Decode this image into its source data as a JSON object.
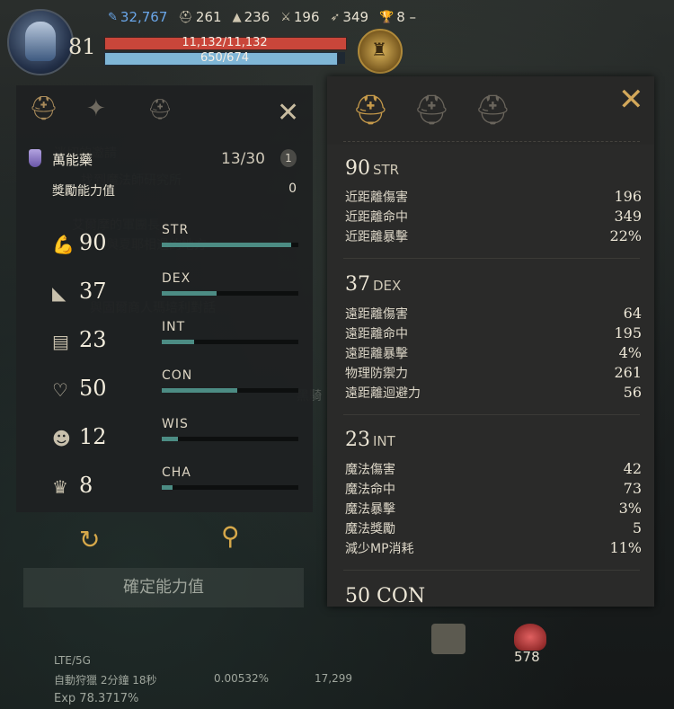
{
  "hud": {
    "level": "81",
    "stats": [
      {
        "icon": "feather-icon",
        "value": "32,767"
      },
      {
        "icon": "helmet-icon",
        "value": "261"
      },
      {
        "icon": "witch-hat-icon",
        "value": "236"
      },
      {
        "icon": "sword-icon",
        "value": "196"
      },
      {
        "icon": "bow-icon",
        "value": "349"
      },
      {
        "icon": "trophy-icon",
        "value": "8 –"
      }
    ],
    "hp": "11,132/11,132",
    "mp": "650/674",
    "mp_fraction": 0.964,
    "colors": {
      "hp": "#c9463a",
      "mp": "#7fb6d6",
      "accent": "#d6a84a"
    }
  },
  "left": {
    "potion": {
      "name": "萬能藥",
      "count": "13/30",
      "info": "1"
    },
    "bonus": {
      "label": "獎勵能力值",
      "value": "0"
    },
    "stats": [
      {
        "abbr": "STR",
        "value": "90",
        "fill": 0.95,
        "icon": "strength-arm-icon"
      },
      {
        "abbr": "DEX",
        "value": "37",
        "fill": 0.4,
        "icon": "boot-icon"
      },
      {
        "abbr": "INT",
        "value": "23",
        "fill": 0.24,
        "icon": "book-icon"
      },
      {
        "abbr": "CON",
        "value": "50",
        "fill": 0.55,
        "icon": "heart-icon"
      },
      {
        "abbr": "WIS",
        "value": "12",
        "fill": 0.12,
        "icon": "head-icon"
      },
      {
        "abbr": "CHA",
        "value": "8",
        "fill": 0.08,
        "icon": "crown-icon"
      }
    ],
    "confirm": "確定能力值",
    "network": "LTE/5G",
    "auto_hunt": "自動狩獵 2分鐘 18秒",
    "gold_rate": "0.00532%",
    "adena": "17,299",
    "exp": "Exp 78.3717%"
  },
  "right": {
    "sections": [
      {
        "value": "90",
        "abbr": "STR",
        "rows": [
          {
            "label": "近距離傷害",
            "value": "196"
          },
          {
            "label": "近距離命中",
            "value": "349"
          },
          {
            "label": "近距離暴擊",
            "value": "22%"
          }
        ]
      },
      {
        "value": "37",
        "abbr": "DEX",
        "rows": [
          {
            "label": "遠距離傷害",
            "value": "64"
          },
          {
            "label": "遠距離命中",
            "value": "195"
          },
          {
            "label": "遠距離暴擊",
            "value": "4%"
          },
          {
            "label": "物理防禦力",
            "value": "261"
          },
          {
            "label": "遠距離迴避力",
            "value": "56"
          }
        ]
      },
      {
        "value": "23",
        "abbr": "INT",
        "rows": [
          {
            "label": "魔法傷害",
            "value": "42"
          },
          {
            "label": "魔法命中",
            "value": "73"
          },
          {
            "label": "魔法暴擊",
            "value": "3%"
          },
          {
            "label": "魔法獎勵",
            "value": "5"
          },
          {
            "label": "減少MP消耗",
            "value": "11%"
          }
        ]
      }
    ],
    "cut_title": "50 CON"
  },
  "bottom": {
    "potion_count": "578"
  }
}
